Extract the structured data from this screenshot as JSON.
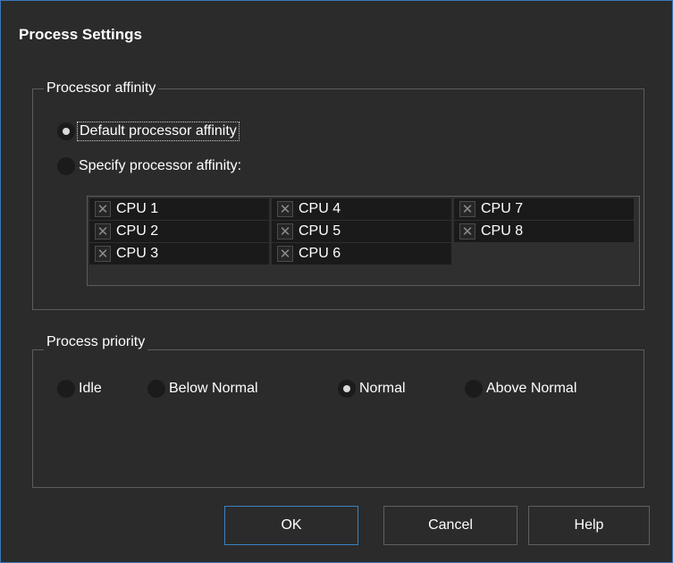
{
  "dialog": {
    "title": "Process Settings"
  },
  "affinity": {
    "group_label": "Processor affinity",
    "default_label": "Default processor affinity",
    "specify_label": "Specify processor affinity:",
    "selected": "default",
    "cpus": [
      {
        "label": "CPU 1",
        "checked": false
      },
      {
        "label": "CPU 2",
        "checked": false
      },
      {
        "label": "CPU 3",
        "checked": false
      },
      {
        "label": "CPU 4",
        "checked": false
      },
      {
        "label": "CPU 5",
        "checked": false
      },
      {
        "label": "CPU 6",
        "checked": false
      },
      {
        "label": "CPU 7",
        "checked": false
      },
      {
        "label": "CPU 8",
        "checked": false
      }
    ],
    "checkbox_glyph": "✕"
  },
  "priority": {
    "group_label": "Process priority",
    "options": [
      "Idle",
      "Below Normal",
      "Normal",
      "Above Normal"
    ],
    "selected": "Normal"
  },
  "buttons": {
    "ok": "OK",
    "cancel": "Cancel",
    "help": "Help"
  },
  "colors": {
    "background": "#2b2b2b",
    "border_accent": "#3b80c4",
    "list_item": "#1a1a1a"
  }
}
